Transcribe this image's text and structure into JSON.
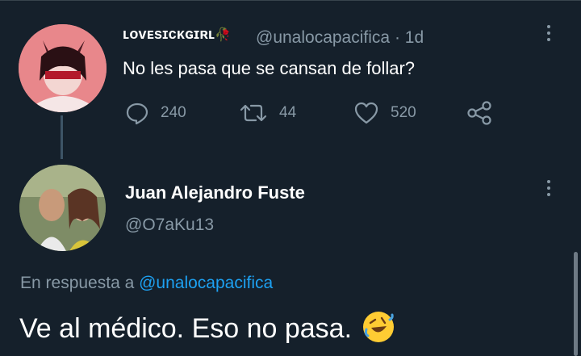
{
  "tweet1": {
    "display_name": "ʟᴏᴠᴇsɪᴄᴋɢɪʀʟ",
    "display_name_emoji": "🥀",
    "handle": "@unalocapacifica",
    "separator": "·",
    "time": "1d",
    "text": "No les pasa que se cansan de follar?",
    "replies": "240",
    "retweets": "44",
    "likes": "520"
  },
  "tweet2": {
    "display_name": "Juan Alejandro Fuste",
    "handle": "@O7aKu13",
    "reply_prefix": "En respuesta a",
    "reply_handle": "@unalocapacifica",
    "text": "Ve al médico. Eso no pasa."
  },
  "colors": {
    "background": "#15202b",
    "secondary_text": "#8899a6",
    "link": "#1da1f2"
  }
}
